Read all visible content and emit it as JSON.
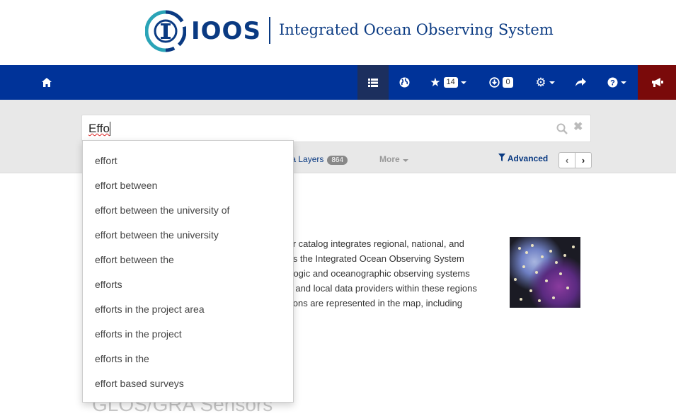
{
  "brand": {
    "logo_text": "IOOS",
    "tagline": "Integrated Ocean Observing System"
  },
  "navbar": {
    "favorites_count": "14",
    "downloads_count": "0"
  },
  "search": {
    "value": "Effo",
    "suggestions": [
      "effort",
      "effort between",
      "effort between the university of",
      "effort between the university",
      "effort between the",
      "efforts",
      "efforts in the project area",
      "efforts in the project",
      "efforts in the",
      "effort based surveys"
    ]
  },
  "tabs": {
    "layers_label": "ta Layers",
    "layers_count": "864",
    "more_label": "More",
    "advanced_label": "Advanced"
  },
  "content": {
    "description": "sor catalog integrates regional, national, and\noss the Integrated Ocean Observing System\nrologic and oceanographic observing systems\nns and local data providers within these regions\nations are represented in the map, including",
    "partial_title": "GLOS/GRA Sensors"
  },
  "colors": {
    "navbar": "#003399",
    "active_tab": "#1c2f5e",
    "alert": "#7a0a0a",
    "brand": "#0a3a82"
  }
}
